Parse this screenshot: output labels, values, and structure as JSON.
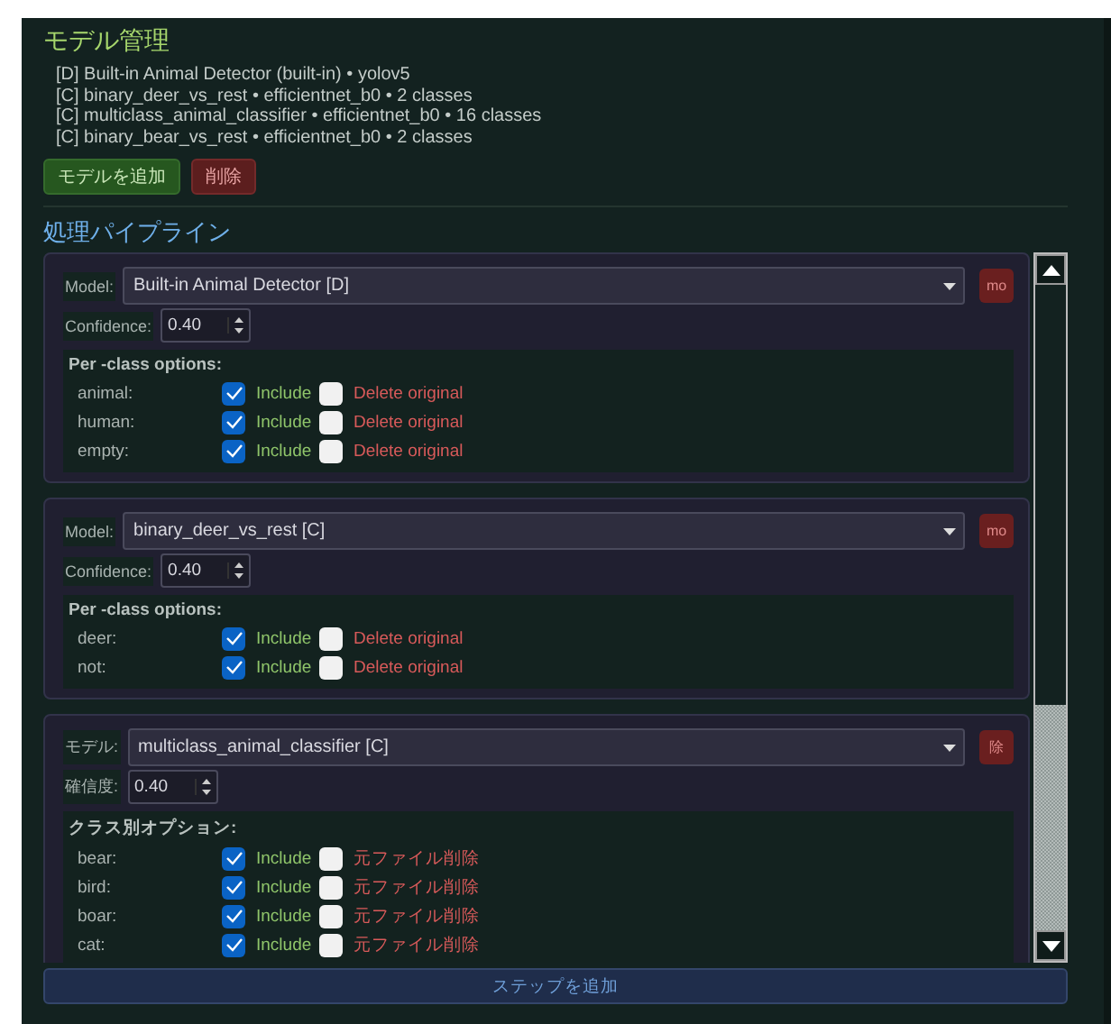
{
  "model_management": {
    "title": "モデル管理",
    "models": [
      "[D] Built-in Animal Detector (built-in) • yolov5",
      "[C] binary_deer_vs_rest • efficientnet_b0 • 2 classes",
      "[C] multiclass_animal_classifier • efficientnet_b0 • 16 classes",
      "[C] binary_bear_vs_rest • efficientnet_b0 • 2 classes"
    ],
    "buttons": [
      {
        "label": "モデルを追加",
        "kind": "add"
      },
      {
        "label": "削除",
        "kind": "delete"
      }
    ]
  },
  "pipeline": {
    "title": "処理パイプライン",
    "steps": [
      {
        "model_label": "Model:",
        "model": "Built-in Animal Detector  [D]",
        "remove": "mo",
        "confidence_label": "Confidence:",
        "confidence": "0.40",
        "options_title": "Per -class options:",
        "classes": [
          {
            "name": "animal:",
            "include": true,
            "include_label": "Include",
            "delete": false,
            "delete_label": "Delete original"
          },
          {
            "name": "human:",
            "include": true,
            "include_label": "Include",
            "delete": false,
            "delete_label": "Delete original"
          },
          {
            "name": "empty:",
            "include": true,
            "include_label": "Include",
            "delete": false,
            "delete_label": "Delete original"
          }
        ]
      },
      {
        "model_label": "Model:",
        "model": "binary_deer_vs_rest  [C]",
        "remove": "mo",
        "confidence_label": "Confidence:",
        "confidence": "0.40",
        "options_title": "Per -class options:",
        "classes": [
          {
            "name": "deer:",
            "include": true,
            "include_label": "Include",
            "delete": false,
            "delete_label": "Delete original"
          },
          {
            "name": "not:",
            "include": true,
            "include_label": "Include",
            "delete": false,
            "delete_label": "Delete original"
          }
        ]
      },
      {
        "model_label": "モデル:",
        "model": "multiclass_animal_classifier  [C]",
        "remove": "除",
        "confidence_label": "確信度:",
        "confidence": "0.40",
        "options_title": "クラス別オプション:",
        "classes": [
          {
            "name": "bear:",
            "include": true,
            "include_label": "Include",
            "delete": false,
            "delete_label": "元ファイル削除"
          },
          {
            "name": "bird:",
            "include": true,
            "include_label": "Include",
            "delete": false,
            "delete_label": "元ファイル削除"
          },
          {
            "name": "boar:",
            "include": true,
            "include_label": "Include",
            "delete": false,
            "delete_label": "元ファイル削除"
          },
          {
            "name": "cat:",
            "include": true,
            "include_label": "Include",
            "delete": false,
            "delete_label": "元ファイル削除"
          }
        ]
      }
    ]
  },
  "add_step": "ステップを追加"
}
